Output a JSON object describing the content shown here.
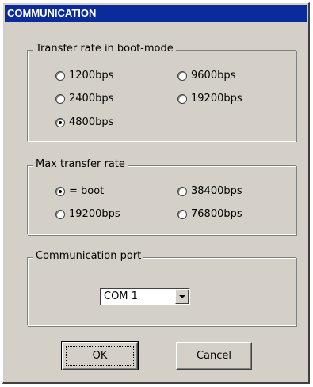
{
  "window": {
    "title": "COMMUNICATION"
  },
  "boot_group": {
    "label": "Transfer rate in boot-mode",
    "options": [
      {
        "label": "1200bps",
        "checked": false
      },
      {
        "label": "9600bps",
        "checked": false
      },
      {
        "label": "2400bps",
        "checked": false
      },
      {
        "label": "19200bps",
        "checked": false
      },
      {
        "label": "4800bps",
        "checked": true
      }
    ]
  },
  "max_group": {
    "label": "Max transfer rate",
    "options": [
      {
        "label": "= boot",
        "checked": true
      },
      {
        "label": "38400bps",
        "checked": false
      },
      {
        "label": "19200bps",
        "checked": false
      },
      {
        "label": "76800bps",
        "checked": false
      }
    ]
  },
  "port_group": {
    "label": "Communication port",
    "select_value": "COM 1"
  },
  "buttons": {
    "ok": "OK",
    "cancel": "Cancel"
  }
}
